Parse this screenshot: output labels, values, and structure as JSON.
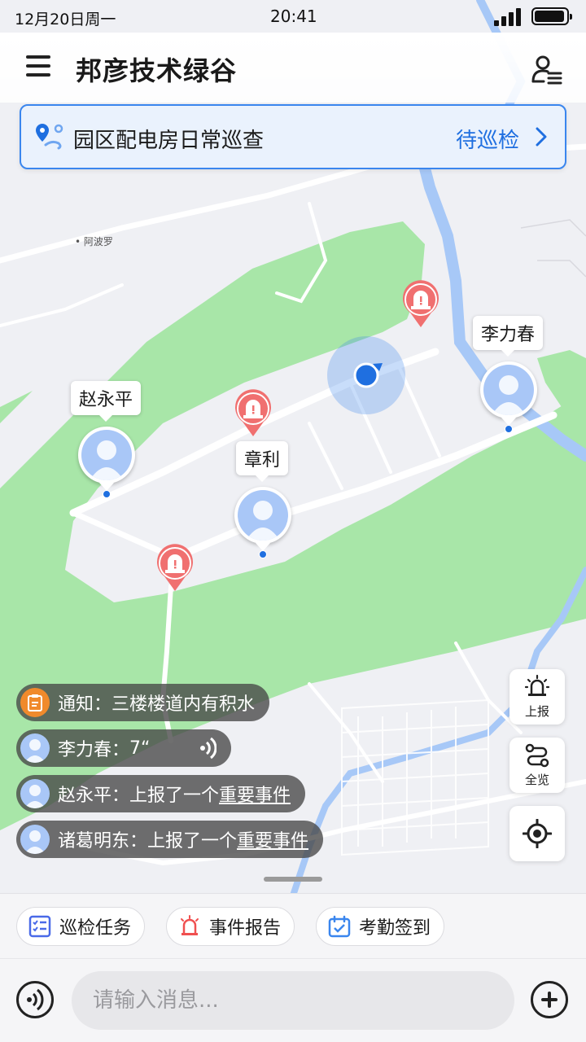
{
  "status_bar": {
    "date": "12月20日周一",
    "time": "20:41"
  },
  "header": {
    "title": "邦彦技术绿谷"
  },
  "task": {
    "title": "园区配电房日常巡查",
    "status": "待巡检"
  },
  "map": {
    "place_label": "阿波罗",
    "users": [
      {
        "name": "李力春"
      },
      {
        "name": "赵永平"
      },
      {
        "name": "章利"
      }
    ]
  },
  "controls": {
    "report": "上报",
    "overview": "全览"
  },
  "messages": [
    {
      "sender": "通知：",
      "text": "三楼楼道内有积水"
    },
    {
      "sender": "李力春：",
      "text": "7“"
    },
    {
      "sender": "赵永平：",
      "text": "上报了一个",
      "link": "重要事件"
    },
    {
      "sender": "诸葛明东：",
      "text": "上报了一个",
      "link": "重要事件"
    }
  ],
  "shortcuts": [
    {
      "label": "巡检任务"
    },
    {
      "label": "事件报告"
    },
    {
      "label": "考勤签到"
    }
  ],
  "input": {
    "placeholder": "请输入消息..."
  },
  "colors": {
    "accent": "#1f6fe0",
    "park": "#a8e6a8",
    "river": "#a7c8f7",
    "alarm": "#f07070"
  }
}
